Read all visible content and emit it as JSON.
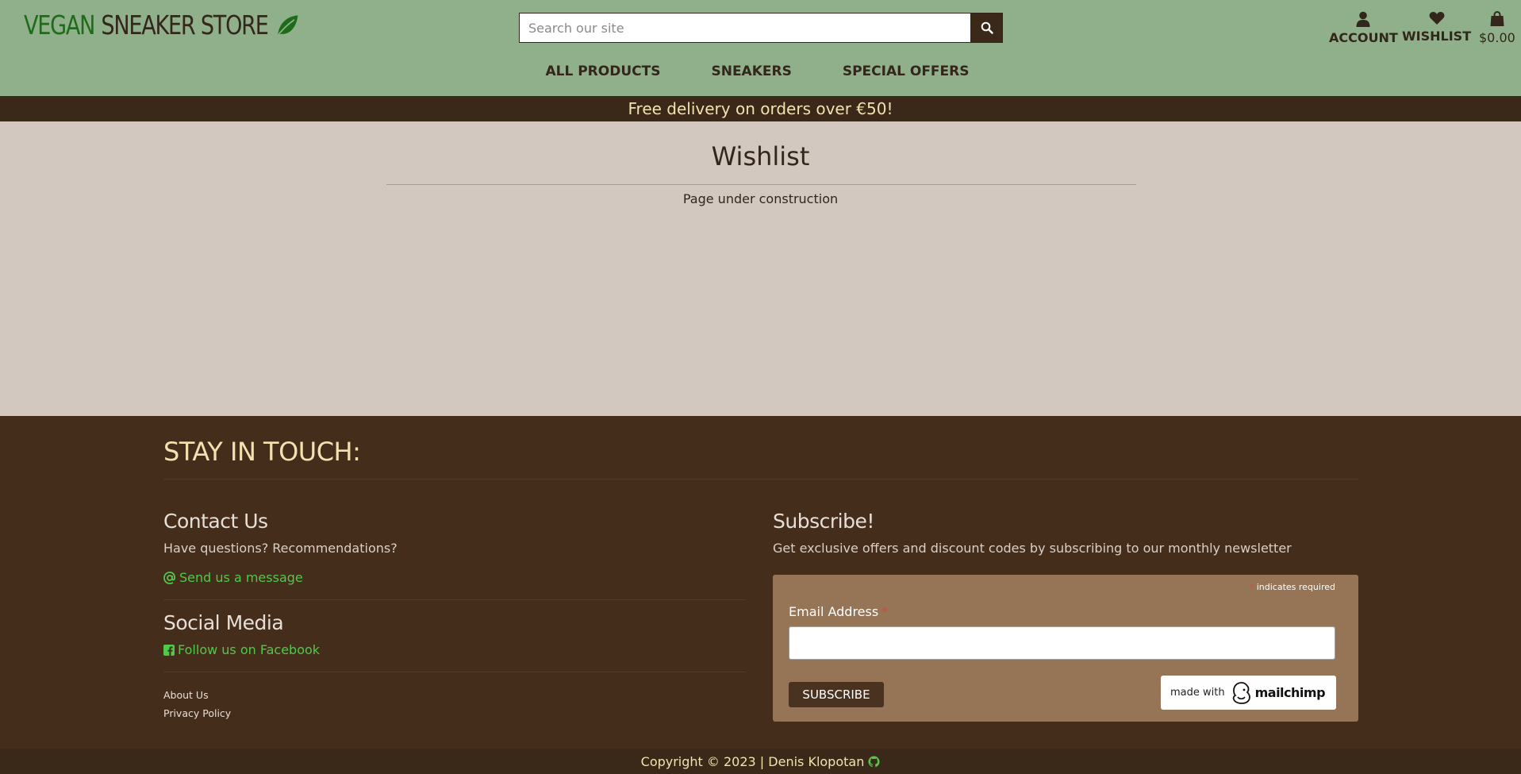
{
  "header": {
    "logo": {
      "green": "VEGAN",
      "dark": "SNEAKER STORE"
    },
    "search": {
      "placeholder": "Search our site",
      "value": ""
    },
    "nav": [
      "ALL PRODUCTS",
      "SNEAKERS",
      "SPECIAL OFFERS"
    ],
    "account": {
      "label": "ACCOUNT",
      "icon": "user-icon"
    },
    "wishlist": {
      "label": "WISHLIST",
      "icon": "heart-icon"
    },
    "bag": {
      "amount": "$0.00",
      "icon": "shopping-bag-icon"
    }
  },
  "banner": {
    "text": "Free delivery on orders over €50!"
  },
  "main": {
    "title": "Wishlist",
    "body": "Page under construction"
  },
  "footer": {
    "title": "STAY IN TOUCH:",
    "contact": {
      "heading": "Contact Us",
      "text": "Have questions? Recommendations?",
      "link": "Send us a message"
    },
    "social": {
      "heading": "Social Media",
      "link": "Follow us on Facebook"
    },
    "links": [
      "About Us",
      "Privacy Policy"
    ],
    "subscribe": {
      "heading": "Subscribe!",
      "text": "Get exclusive offers and discount codes by subscribing to our monthly newsletter",
      "required_note": "indicates required",
      "email_label": "Email Address",
      "email_value": "",
      "button": "SUBSCRIBE",
      "badge_prefix": "made with",
      "badge_brand": "mailchimp"
    }
  },
  "copyright": {
    "text": "Copyright © 2023 | Denis Klopotan"
  },
  "colors": {
    "header_bg": "#8fb08b",
    "banner_bg": "#3a2818",
    "banner_text": "#f3e1b0",
    "page_bg": "#d2c8bf",
    "footer_bg": "#452d1c",
    "link_green": "#4fc94a",
    "form_bg": "#967456"
  }
}
